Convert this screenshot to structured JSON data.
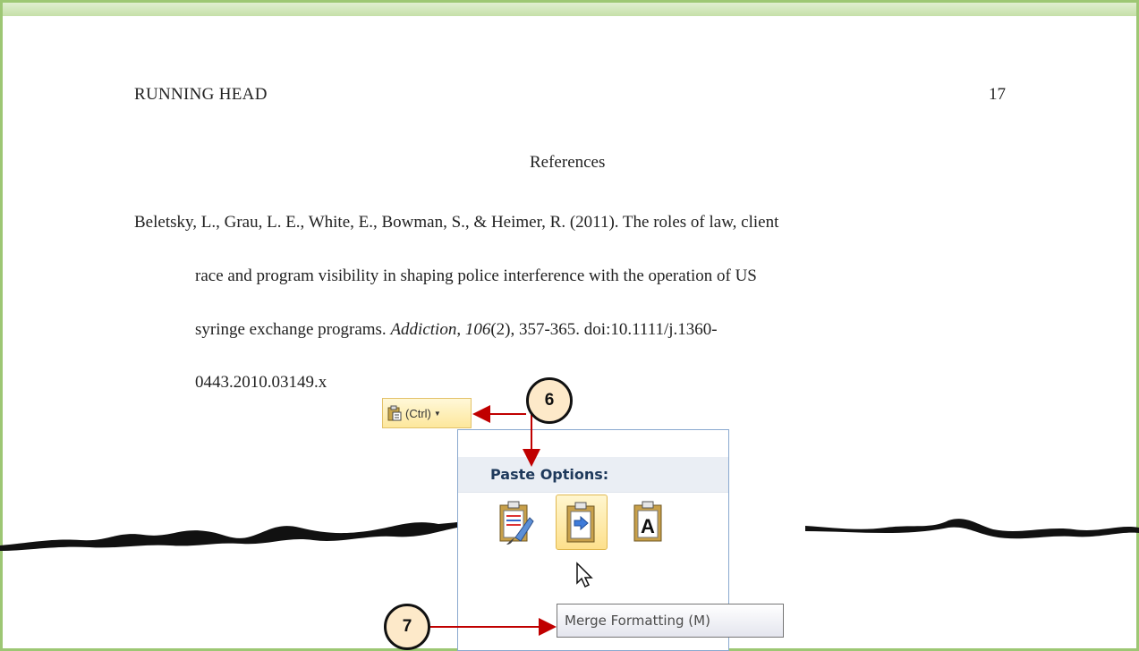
{
  "document": {
    "running_head": "RUNNING HEAD",
    "page_number": "17",
    "references_title": "References",
    "reference": {
      "line1": "Beletsky, L., Grau, L. E., White, E., Bowman, S., & Heimer, R. (2011). The roles of law, client",
      "line2": "race and program visibility in shaping police interference with the operation of US",
      "line3_before": "syringe exchange programs. ",
      "journal": "Addiction",
      "sep": ", ",
      "volume": "106",
      "line3_after": "(2), 357-365. doi:10.1111/j.1360-",
      "line4": "0443.2010.03149.x"
    }
  },
  "paste_button": {
    "label": "(Ctrl)",
    "icon": "clipboard-icon",
    "arrow_icon": "dropdown-arrow-icon"
  },
  "paste_options": {
    "header": "Paste Options:",
    "icons": [
      "keep-source-formatting-icon",
      "merge-formatting-icon",
      "keep-text-only-icon"
    ],
    "text_only_glyph": "A",
    "selected": "merge-formatting-icon"
  },
  "tooltip": {
    "text": "Merge Formatting (M)"
  },
  "callouts": {
    "step6": "6",
    "step7": "7"
  },
  "colors": {
    "frame": "#9dc774",
    "arrow": "#c00000",
    "highlight": "#fde08c",
    "panel_border": "#8aa9cf"
  }
}
